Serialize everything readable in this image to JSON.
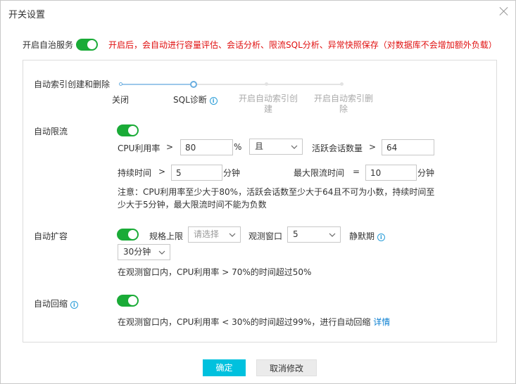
{
  "dialog": {
    "title": "开关设置"
  },
  "auto_service": {
    "label": "开启自治服务",
    "enabled": true,
    "warning": "开启后，会自动进行容量评估、会话分析、限流SQL分析、异常快照保存（对数据库不会增加额外负载）"
  },
  "auto_index": {
    "label": "自动索引创建和删除",
    "steps": [
      "关闭",
      "SQL诊断",
      "开启自动索引创\n建",
      "开启自动索引删\n除"
    ],
    "selected_index": 1,
    "info_icon": "info-icon"
  },
  "auto_throttle": {
    "label": "自动限流",
    "enabled": true,
    "cpu_label": "CPU利用率",
    "gt1": ">",
    "cpu_value": "80",
    "pct": "%",
    "logic_value": "且",
    "sessions_label": "活跃会话数量",
    "gt2": ">",
    "sessions_value": "64",
    "duration_label": "持续时间",
    "gt3": ">",
    "duration_value": "5",
    "duration_unit": "分钟",
    "max_label": "最大限流时间",
    "eq": "=",
    "max_value": "10",
    "max_unit": "分钟",
    "note": "注意：CPU利用率至少大于80%，活跃会话数至少大于64且不可为小数，持续时间至少大于5分钟，最大限流时间不能为负数"
  },
  "auto_scale": {
    "label": "自动扩容",
    "enabled": true,
    "spec_label": "规格上限",
    "spec_placeholder": "请选择",
    "window_label": "观测窗口",
    "window_value": "5",
    "quiet_label": "静默期",
    "quiet_value": "30分钟",
    "desc": "在观测窗口内，CPU利用率 > 70%的时间超过50%"
  },
  "auto_shrink": {
    "label": "自动回缩",
    "enabled": true,
    "desc": "在观测窗口内，CPU利用率 < 30%的时间超过99%，进行自动回缩",
    "detail_link": "详情"
  },
  "footer": {
    "ok_label": "确定",
    "cancel_label": "取消修改"
  },
  "colors": {
    "switch_on": "#1aab37",
    "primary": "#00c1de",
    "warning": "#e01010",
    "link": "#0b7fd1",
    "info": "#2a9dd8"
  }
}
